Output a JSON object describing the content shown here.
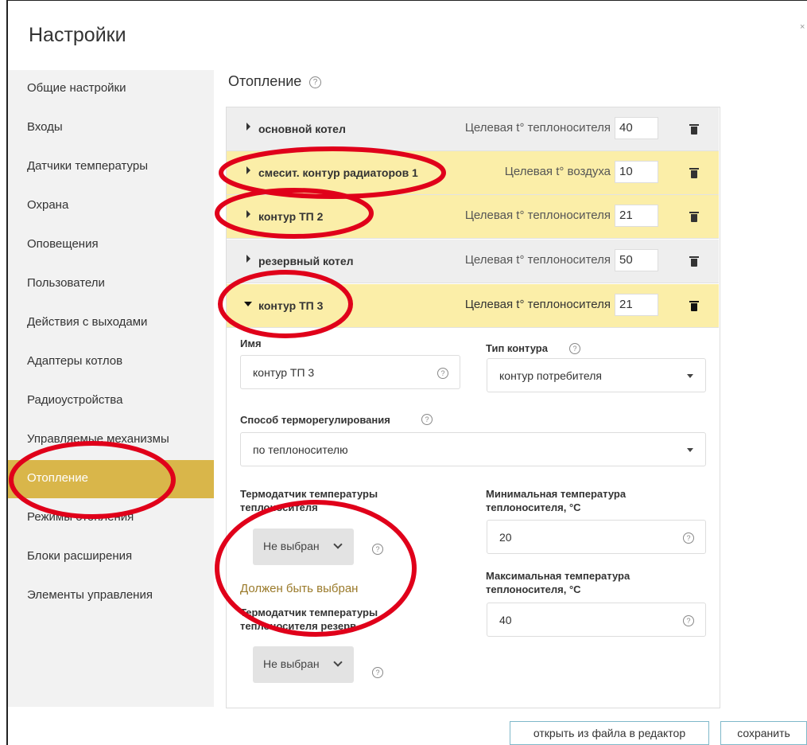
{
  "window": {
    "title": "Настройки"
  },
  "sidebar": {
    "items": [
      {
        "label": "Общие настройки",
        "active": false
      },
      {
        "label": "Входы",
        "active": false
      },
      {
        "label": "Датчики температуры",
        "active": false
      },
      {
        "label": "Охрана",
        "active": false
      },
      {
        "label": "Оповещения",
        "active": false
      },
      {
        "label": "Пользователи",
        "active": false
      },
      {
        "label": "Действия с выходами",
        "active": false
      },
      {
        "label": "Адаптеры котлов",
        "active": false
      },
      {
        "label": "Радиоустройства",
        "active": false
      },
      {
        "label": "Управляемые механизмы",
        "active": false
      },
      {
        "label": "Отопление",
        "active": true
      },
      {
        "label": "Режимы отопления",
        "active": false
      },
      {
        "label": "Блоки расширения",
        "active": false
      },
      {
        "label": "Элементы управления",
        "active": false
      }
    ]
  },
  "main": {
    "section_title": "Отопление",
    "help_icon": "question-circle-icon",
    "circuits": [
      {
        "name": "основной котел",
        "target_label": "Целевая t° теплоносителя",
        "target_value": "40",
        "style": "gray",
        "expanded": false
      },
      {
        "name": "смесит. контур радиаторов 1",
        "target_label": "Целевая t° воздуха",
        "target_value": "10",
        "style": "yellow",
        "expanded": false
      },
      {
        "name": "контур ТП 2",
        "target_label": "Целевая t° теплоносителя",
        "target_value": "21",
        "style": "yellow",
        "expanded": false
      },
      {
        "name": "резервный котел",
        "target_label": "Целевая t° теплоносителя",
        "target_value": "50",
        "style": "gray",
        "expanded": false
      },
      {
        "name": "контур ТП 3",
        "target_label": "Целевая t° теплоносителя",
        "target_value": "21",
        "style": "yellow",
        "expanded": true
      }
    ],
    "details": {
      "name_label": "Имя",
      "name_value": "контур ТП 3",
      "type_label": "Тип контура",
      "type_value": "контур потребителя",
      "method_label": "Способ терморегулирования",
      "method_value": "по теплоносителю",
      "sensor_label_line1": "Термодатчик температуры",
      "sensor_label_line2": "теплоносителя",
      "sensor_value": "Не выбран",
      "sensor_warning": "Должен быть выбран",
      "reserve_sensor_label_line1": "Термодатчик температуры",
      "reserve_sensor_label_line2": "теплоносителя резерв",
      "reserve_sensor_value": "Не выбран",
      "min_temp_label_line1": "Минимальная температура",
      "min_temp_label_line2": "теплоносителя, °C",
      "min_temp_value": "20",
      "max_temp_label_line1": "Максимальная температура",
      "max_temp_label_line2": "теплоносителя, °C",
      "max_temp_value": "40"
    }
  },
  "footer": {
    "open_editor_label": "открыть из файла в редактор",
    "save_label": "сохранить"
  },
  "colors": {
    "accent": "#d9b64a",
    "highlight_row": "#fbeea8",
    "annotation": "#e0001a"
  },
  "close_mark": "×"
}
